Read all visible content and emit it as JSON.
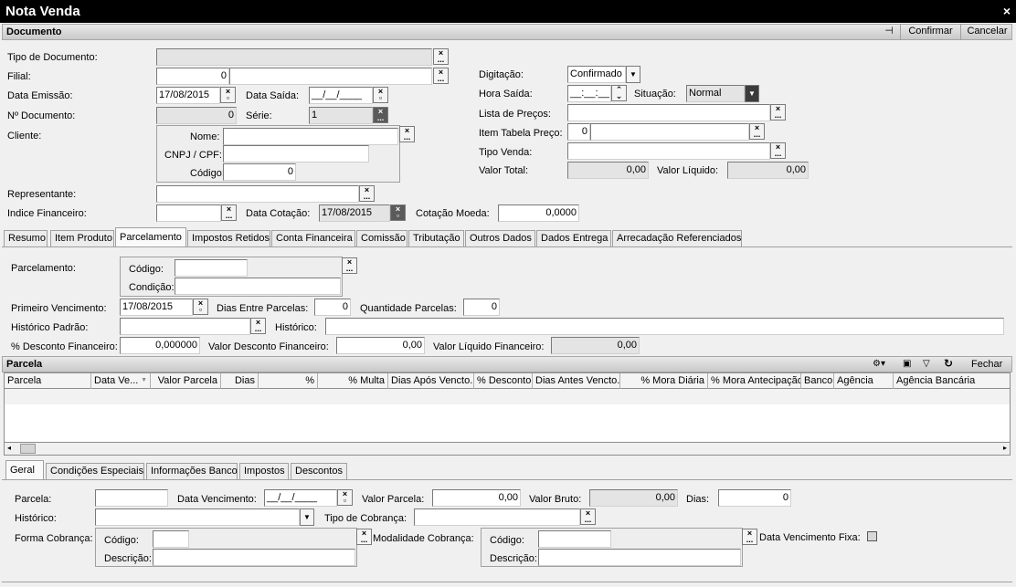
{
  "window": {
    "title": "Nota Venda",
    "close": "×"
  },
  "documento": {
    "title": "Documento",
    "pin_icon": "pin-icon",
    "confirmar": "Confirmar",
    "cancelar": "Cancelar"
  },
  "fields": {
    "tipo_documento": {
      "label": "Tipo de Documento:",
      "value": ""
    },
    "filial": {
      "label": "Filial:",
      "value": "0",
      "name": ""
    },
    "data_emissao": {
      "label": "Data Emissão:",
      "value": "17/08/2015"
    },
    "data_saida": {
      "label": "Data Saída:",
      "value": "__/__/____"
    },
    "n_documento": {
      "label": "Nº Documento:",
      "value": "0"
    },
    "serie": {
      "label": "Série:",
      "value": "1"
    },
    "cliente": {
      "label": "Cliente:",
      "nome_label": "Nome:",
      "nome": "",
      "cnpj_label": "CNPJ / CPF:",
      "cnpj": "",
      "codigo_label": "Código:",
      "codigo": "0"
    },
    "representante": {
      "label": "Representante:",
      "value": ""
    },
    "indice_financeiro": {
      "label": "Indice Financeiro:",
      "value": ""
    },
    "data_cotacao": {
      "label": "Data Cotação:",
      "value": "17/08/2015"
    },
    "cotacao_moeda": {
      "label": "Cotação Moeda:",
      "value": "0,0000"
    },
    "digitacao": {
      "label": "Digitação:",
      "value": "Confirmado"
    },
    "hora_saida": {
      "label": "Hora Saída:",
      "value": "__:__:__"
    },
    "situacao": {
      "label": "Situação:",
      "value": "Normal"
    },
    "lista_precos": {
      "label": "Lista de Preços:",
      "value": ""
    },
    "item_tabela_preco": {
      "label": "Item Tabela Preço:",
      "value": "0",
      "name": ""
    },
    "tipo_venda": {
      "label": "Tipo Venda:",
      "value": ""
    },
    "valor_total": {
      "label": "Valor Total:",
      "value": "0,00"
    },
    "valor_liquido": {
      "label": "Valor Líquido:",
      "value": "0,00"
    }
  },
  "tabs": [
    "Resumo",
    "Item Produto",
    "Parcelamento",
    "Impostos Retidos",
    "Conta Financeira",
    "Comissão",
    "Tributação",
    "Outros Dados",
    "Dados Entrega",
    "Arrecadação Referenciados"
  ],
  "parcelamento": {
    "label": "Parcelamento:",
    "codigo_label": "Código:",
    "codigo": "",
    "condicao_label": "Condição:",
    "condicao": "",
    "primeiro_venc_label": "Primeiro Vencimento:",
    "primeiro_venc": "17/08/2015",
    "dias_entre_label": "Dias Entre Parcelas:",
    "dias_entre": "0",
    "qtd_parcelas_label": "Quantidade Parcelas:",
    "qtd_parcelas": "0",
    "historico_padrao_label": "Histórico Padrão:",
    "historico_padrao": "",
    "historico_label": "Histórico:",
    "historico": "",
    "desc_fin_label": "% Desconto Financeiro:",
    "desc_fin": "0,000000",
    "valor_desc_fin_label": "Valor Desconto Financeiro:",
    "valor_desc_fin": "0,00",
    "valor_liq_fin_label": "Valor Líquido Financeiro:",
    "valor_liq_fin": "0,00"
  },
  "parcela_grid": {
    "title": "Parcela",
    "fechar": "Fechar",
    "columns": [
      "Parcela",
      "Data Ve...",
      "Valor Parcela",
      "Dias",
      "%",
      "% Multa",
      "Dias Após Vencto.",
      "% Desconto",
      "Dias Antes Vencto.",
      "% Mora Diária",
      "% Mora Antecipação",
      "Banco",
      "Agência",
      "Agência Bancária"
    ]
  },
  "subtabs": [
    "Geral",
    "Condições Especiais",
    "Informações Banco",
    "Impostos",
    "Descontos"
  ],
  "geral": {
    "parcela_label": "Parcela:",
    "parcela": "",
    "data_venc_label": "Data Vencimento:",
    "data_venc": "__/__/____",
    "valor_parcela_label": "Valor Parcela:",
    "valor_parcela": "0,00",
    "valor_bruto_label": "Valor Bruto:",
    "valor_bruto": "0,00",
    "dias_label": "Dias:",
    "dias": "0",
    "historico_label": "Histórico:",
    "historico": "",
    "tipo_cobranca_label": "Tipo de Cobrança:",
    "tipo_cobranca": "",
    "forma_cobranca_label": "Forma Cobrança:",
    "fc_codigo_label": "Código:",
    "fc_codigo": "",
    "fc_desc_label": "Descrição:",
    "fc_desc": "",
    "modalidade_label": "Modalidade Cobrança:",
    "mc_codigo_label": "Código:",
    "mc_codigo": "",
    "mc_desc_label": "Descrição:",
    "mc_desc": "",
    "data_venc_fixa_label": "Data Vencimento Fixa:"
  }
}
